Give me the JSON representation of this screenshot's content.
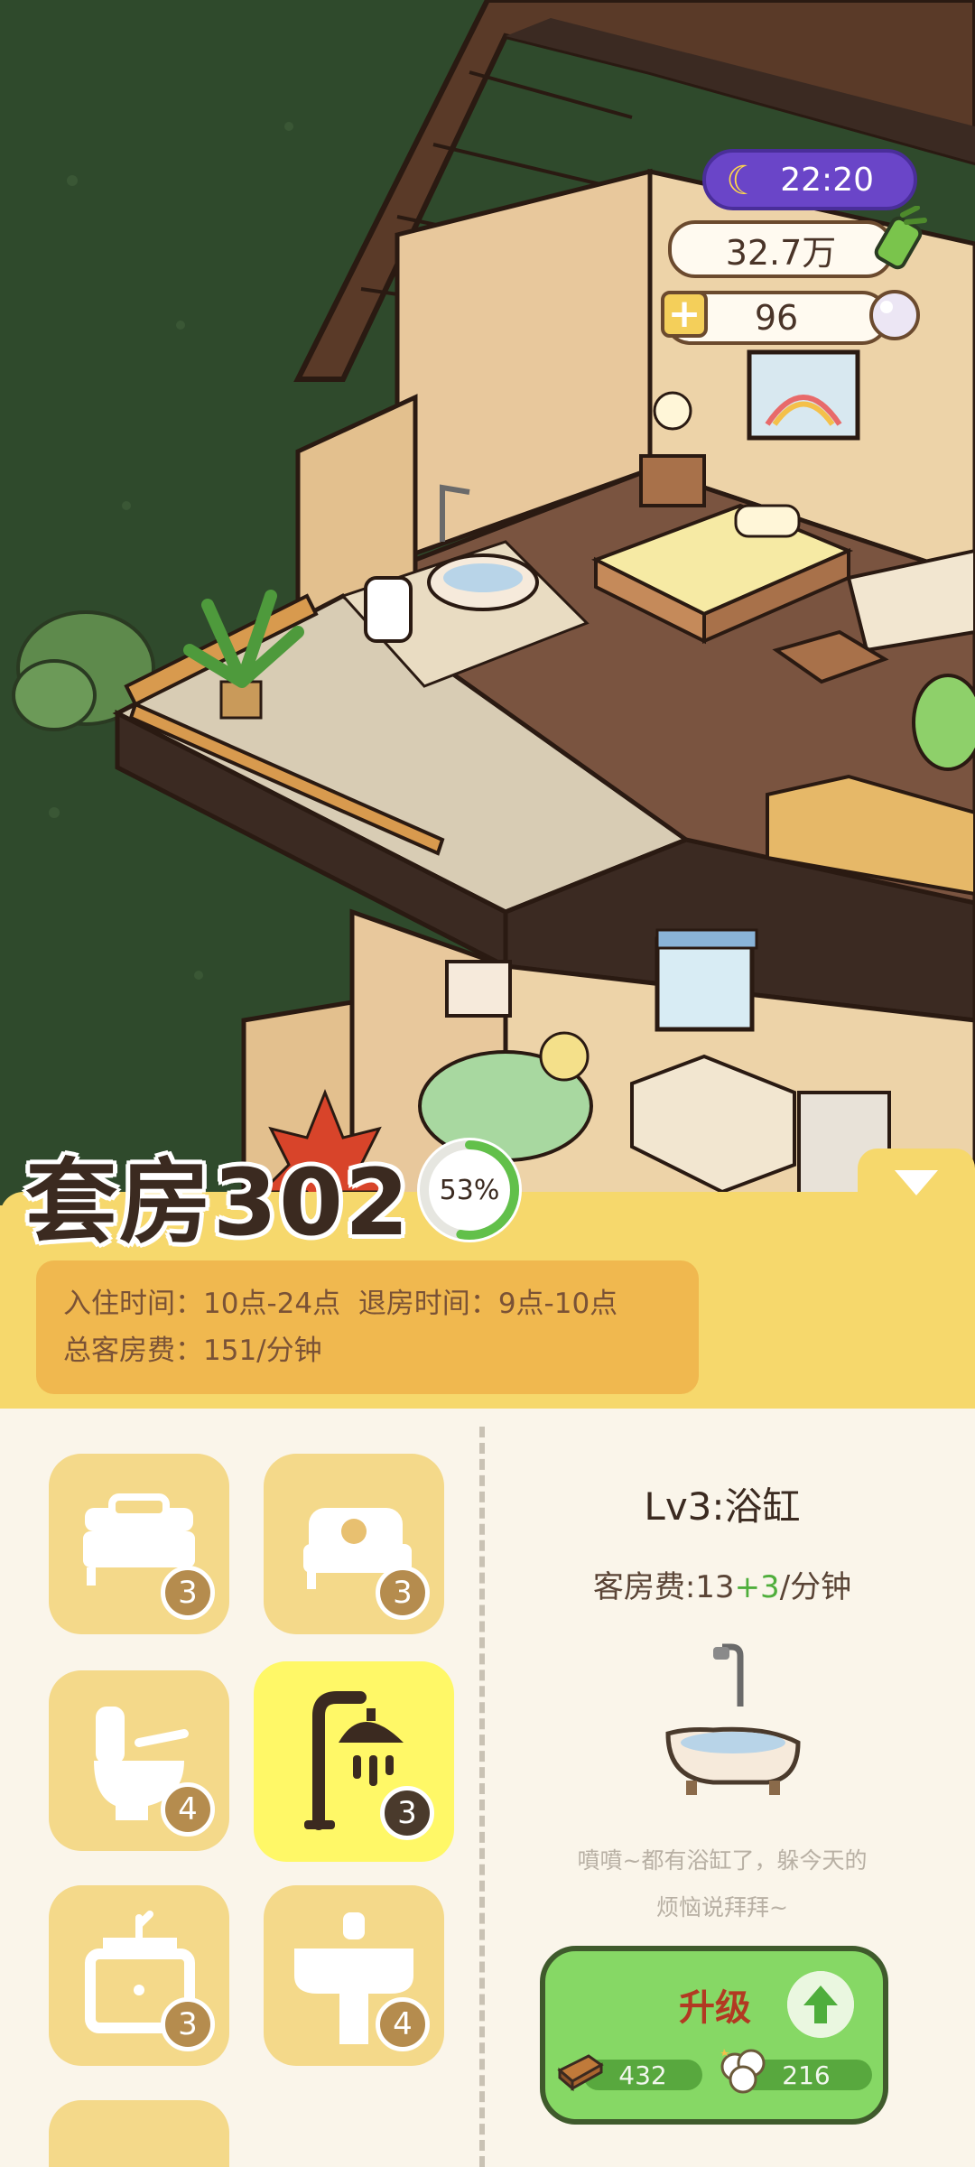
{
  "hud": {
    "time": "22:20",
    "coins": "32.7万",
    "pearls": "96",
    "plus_label": "+"
  },
  "room": {
    "title": "套房302",
    "occupancy_percent_label": "53%",
    "occupancy_fraction": 0.53,
    "checkin_label": "入住时间",
    "checkin_value": "10点-24点",
    "checkout_label": "退房时间",
    "checkout_value": "9点-10点",
    "total_fee_label": "总客房费",
    "total_fee_value": "151/分钟"
  },
  "categories": [
    {
      "icon": "bed-icon",
      "level": "3"
    },
    {
      "icon": "bed-side-icon",
      "level": "3"
    },
    {
      "icon": "toilet-icon",
      "level": "4"
    },
    {
      "icon": "shower-icon",
      "level": "3",
      "selected": true
    },
    {
      "icon": "nightstand-icon",
      "level": "3"
    },
    {
      "icon": "sink-icon",
      "level": "4"
    }
  ],
  "detail": {
    "title": "Lv3:浴缸",
    "fee_prefix": "客房费:13",
    "fee_plus": "+3",
    "fee_suffix": "/分钟",
    "desc_line1": "噴噴~都有浴缸了，躲今天的",
    "desc_line2": "烦恼说拜拜~"
  },
  "upgrade": {
    "label": "升级",
    "wood_cost": "432",
    "cotton_cost": "216"
  },
  "colors": {
    "panel_yellow": "#f6d86c",
    "info_box": "#f0b84f",
    "selected_tile": "#fff867",
    "tile": "#f4d98a",
    "upgrade_green": "#86d865"
  }
}
